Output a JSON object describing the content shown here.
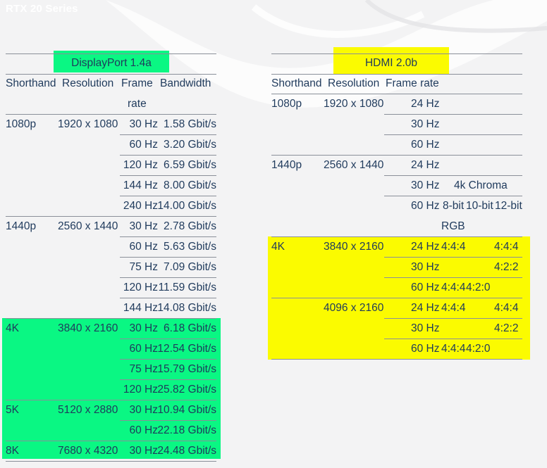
{
  "page_title": "RTX 20 Series",
  "colors": {
    "displayport_highlight": "#0af783",
    "hdmi_highlight": "#fbfb00",
    "text": "#1f3a5c"
  },
  "dp": {
    "title": "DisplayPort 1.4a",
    "headers": {
      "shorthand": "Shorthand",
      "resolution": "Resolution",
      "frame_rate_1": "Frame",
      "frame_rate_2": "rate",
      "bandwidth": "Bandwidth"
    },
    "rows": [
      {
        "shorthand": "1080p",
        "resolution": "1920 x 1080",
        "rate": "30 Hz",
        "bandwidth": "1.58 Gbit/s"
      },
      {
        "rate": "60 Hz",
        "bandwidth": "3.20 Gbit/s"
      },
      {
        "rate": "120 Hz",
        "bandwidth": "6.59 Gbit/s"
      },
      {
        "rate": "144 Hz",
        "bandwidth": "8.00 Gbit/s"
      },
      {
        "rate": "240 Hz",
        "bandwidth": "14.00 Gbit/s"
      },
      {
        "shorthand": "1440p",
        "resolution": "2560 x 1440",
        "rate": "30 Hz",
        "bandwidth": "2.78 Gbit/s"
      },
      {
        "rate": "60 Hz",
        "bandwidth": "5.63 Gbit/s"
      },
      {
        "rate": "75 Hz",
        "bandwidth": "7.09 Gbit/s"
      },
      {
        "rate": "120 Hz",
        "bandwidth": "11.59 Gbit/s"
      },
      {
        "rate": "144 Hz",
        "bandwidth": "14.08 Gbit/s"
      },
      {
        "shorthand": "4K",
        "resolution": "3840 x 2160",
        "rate": "30 Hz",
        "bandwidth": "6.18 Gbit/s"
      },
      {
        "rate": "60 Hz",
        "bandwidth": "12.54 Gbit/s"
      },
      {
        "rate": "75 Hz",
        "bandwidth": "15.79 Gbit/s"
      },
      {
        "rate": "120 Hz",
        "bandwidth": "25.82 Gbit/s"
      },
      {
        "shorthand": "5K",
        "resolution": "5120 x 2880",
        "rate": "30 Hz",
        "bandwidth": "10.94 Gbit/s"
      },
      {
        "rate": "60 Hz",
        "bandwidth": "22.18 Gbit/s"
      },
      {
        "shorthand": "8K",
        "resolution": "7680 x 4320",
        "rate": "30 Hz",
        "bandwidth": "24.48 Gbit/s"
      }
    ]
  },
  "hdmi": {
    "title": "HDMI 2.0b",
    "headers": {
      "shorthand": "Shorthand",
      "resolution": "Resolution",
      "frame_rate": "Frame rate"
    },
    "chroma_header": "4k Chroma",
    "chroma_sub": {
      "bit8": "8-bit",
      "bit10": "10-bit",
      "bit12": "12-bit",
      "rgb": "RGB"
    },
    "rows": [
      {
        "shorthand": "1080p",
        "resolution": "1920 x 1080",
        "rate": "24 Hz"
      },
      {
        "rate": "30 Hz"
      },
      {
        "rate": "60 Hz"
      },
      {
        "shorthand": "1440p",
        "resolution": "2560 x 1440",
        "rate": "24 Hz"
      },
      {
        "rate": "30 Hz"
      },
      {
        "rate": "60 Hz"
      },
      {
        "shorthand": "4K",
        "resolution": "3840 x 2160",
        "rate": "24 Hz",
        "bit8": "4:4:4",
        "bit12": "4:4:4"
      },
      {
        "rate": "30 Hz",
        "bit12": "4:2:2"
      },
      {
        "rate": "60 Hz",
        "bit8": "4:4:4",
        "bit10": "4:2:0"
      },
      {
        "resolution": "4096 x 2160",
        "rate": "24 Hz",
        "bit8": "4:4:4",
        "bit12": "4:4:4"
      },
      {
        "rate": "30 Hz",
        "bit12": "4:2:2"
      },
      {
        "rate": "60 Hz",
        "bit8": "4:4:4",
        "bit10": "4:2:0"
      }
    ]
  }
}
